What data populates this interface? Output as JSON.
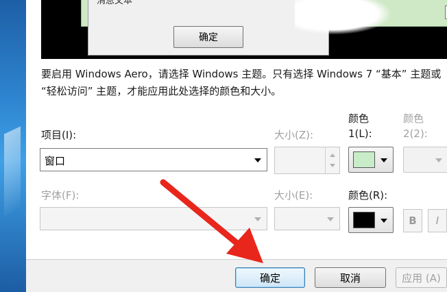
{
  "preview": {
    "box_title": "消息文本",
    "ok_label": "确定",
    "scroll_glyph": "▼"
  },
  "description": "要启用 Windows Aero，请选择 Windows 主题。只有选择 Windows 7 “基本” 主题或 “轻松访问” 主题，才能应用此处选择的颜色和大小。",
  "form": {
    "item_label": "项目(I):",
    "item_value": "窗口",
    "size_z_label": "大小(Z):",
    "color1_label_line1": "颜色",
    "color1_label_line2": "1(L):",
    "color2_label_line1": "颜色",
    "color2_label_line2": "2(2):",
    "color1_value": "#c9ecc8",
    "font_label": "字体(F):",
    "size_e_label": "大小(E):",
    "color_r_label": "颜色(R):",
    "font_color_value": "#000000",
    "bold_label": "B",
    "italic_label": "I"
  },
  "footer": {
    "ok_label": "确定",
    "cancel_label": "取消",
    "apply_label": "应用 (A)"
  },
  "colors": {
    "annotation_arrow": "#e8261c"
  }
}
